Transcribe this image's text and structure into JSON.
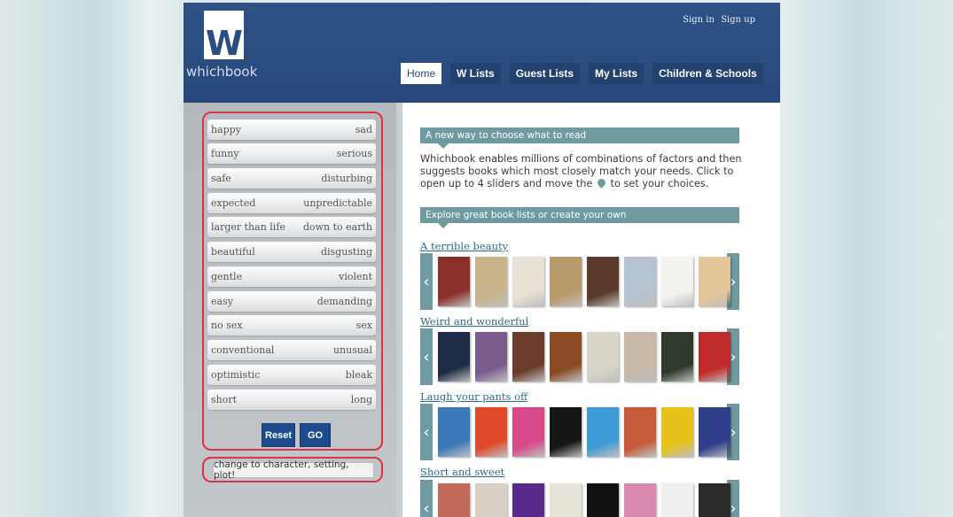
{
  "header": {
    "logo_letter": "W",
    "logo_text": "whichbook",
    "sign_in": "Sign in",
    "sign_up": "Sign up",
    "nav": [
      {
        "label": "Home"
      },
      {
        "label": "W Lists"
      },
      {
        "label": "Guest Lists"
      },
      {
        "label": "My Lists"
      },
      {
        "label": "Children & Schools"
      }
    ]
  },
  "sliders": [
    {
      "left": "happy",
      "right": "sad"
    },
    {
      "left": "funny",
      "right": "serious"
    },
    {
      "left": "safe",
      "right": "disturbing"
    },
    {
      "left": "expected",
      "right": "unpredictable"
    },
    {
      "left": "larger than life",
      "right": "down to earth"
    },
    {
      "left": "beautiful",
      "right": "disgusting"
    },
    {
      "left": "gentle",
      "right": "violent"
    },
    {
      "left": "easy",
      "right": "demanding"
    },
    {
      "left": "no sex",
      "right": "sex"
    },
    {
      "left": "conventional",
      "right": "unusual"
    },
    {
      "left": "optimistic",
      "right": "bleak"
    },
    {
      "left": "short",
      "right": "long"
    }
  ],
  "buttons": {
    "reset": "Reset",
    "go": "GO",
    "change": "change to character, setting, plot!"
  },
  "main": {
    "banner1": "A new way to choose what to read",
    "intro_part1": "Whichbook enables millions of combinations of factors and then suggests books which most closely match your needs. Click to open up to 4 sliders and move the",
    "intro_part2": "to set your choices.",
    "banner2": "Explore great book lists or create your own",
    "lists": [
      {
        "title": "A terrible beauty",
        "covers": [
          "#8b2f2a",
          "#c9b38a",
          "#e7e1d6",
          "#b89a6a",
          "#5a3a2a",
          "#b6c3d0",
          "#f4f2ee",
          "#e3c79a"
        ]
      },
      {
        "title": "Weird and wonderful",
        "covers": [
          "#1f2a44",
          "#7a5c8c",
          "#6b3b2b",
          "#8a4a24",
          "#d9d4c9",
          "#c9b7a8",
          "#2f3a2c",
          "#c12a2a"
        ]
      },
      {
        "title": "Laugh your pants off",
        "covers": [
          "#3a78b8",
          "#e04a2a",
          "#d94a8a",
          "#161616",
          "#3f9bd6",
          "#c75a3a",
          "#e6c21a",
          "#2f3f8a"
        ]
      },
      {
        "title": "Short and sweet",
        "covers": [
          "#c46a5a",
          "#d8d0c4",
          "#5a2a8a",
          "#e9e4da",
          "#111111",
          "#d98aaf",
          "#efefef",
          "#2a2a2a"
        ]
      }
    ]
  }
}
